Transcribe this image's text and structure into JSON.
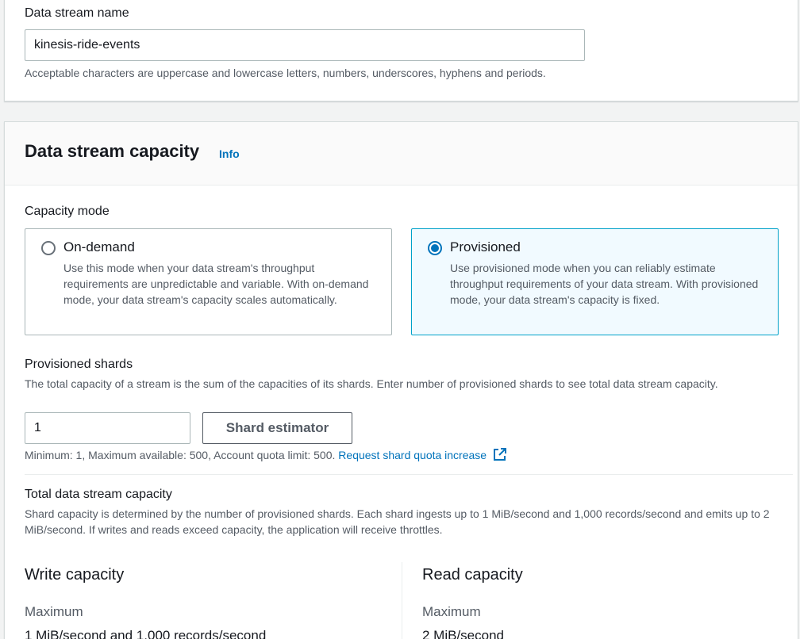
{
  "stream_name": {
    "label": "Data stream name",
    "value": "kinesis-ride-events",
    "hint": "Acceptable characters are uppercase and lowercase letters, numbers, underscores, hyphens and periods."
  },
  "capacity": {
    "title": "Data stream capacity",
    "info_link": "Info",
    "mode_label": "Capacity mode",
    "modes": [
      {
        "title": "On-demand",
        "description": "Use this mode when your data stream's throughput requirements are unpredictable and variable. With on-demand mode, your data stream's capacity scales automatically.",
        "selected": false
      },
      {
        "title": "Provisioned",
        "description": "Use provisioned mode when you can reliably estimate throughput requirements of your data stream. With provisioned mode, your data stream's capacity is fixed.",
        "selected": true
      }
    ],
    "shards": {
      "label": "Provisioned shards",
      "description": "The total capacity of a stream is the sum of the capacities of its shards. Enter number of provisioned shards to see total data stream capacity.",
      "value": "1",
      "estimator_button": "Shard estimator",
      "limits_text": "Minimum: 1, Maximum available: 500, Account quota limit: 500.",
      "quota_link": "Request shard quota increase"
    },
    "total": {
      "label": "Total data stream capacity",
      "description": "Shard capacity is determined by the number of provisioned shards. Each shard ingests up to 1 MiB/second and 1,000 records/second and emits up to 2 MiB/second. If writes and reads exceed capacity, the application will receive throttles.",
      "write": {
        "title": "Write capacity",
        "key": "Maximum",
        "value": "1 MiB/second and 1,000 records/second"
      },
      "read": {
        "title": "Read capacity",
        "key": "Maximum",
        "value": "2 MiB/second"
      }
    }
  },
  "colors": {
    "accent": "#0073bb",
    "selected_border": "#00a1c9",
    "selected_bg": "#f1faff"
  },
  "icons": {
    "radio_on": "radio-selected-icon",
    "radio_off": "radio-unselected-icon",
    "external_link": "external-link-icon"
  }
}
